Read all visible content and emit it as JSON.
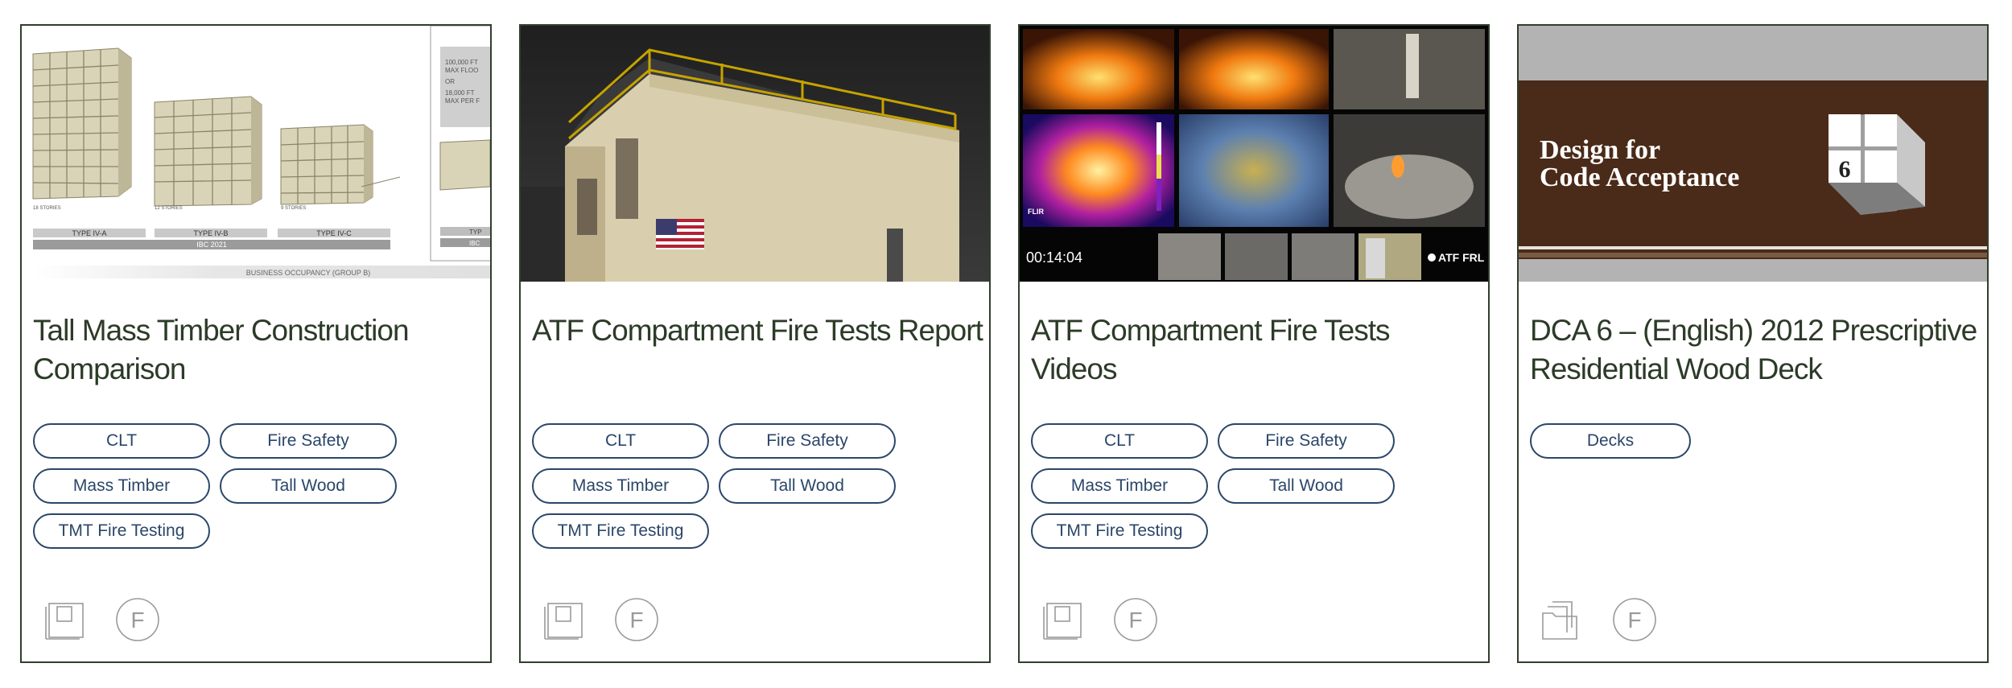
{
  "cards": [
    {
      "title": "Tall Mass Timber Construction Comparison",
      "tags": [
        "CLT",
        "Fire Safety",
        "Mass Timber",
        "Tall Wood",
        "TMT Fire Testing"
      ],
      "thumb": {
        "labels": [
          "TYPE IV-A",
          "TYPE IV-B",
          "TYPE IV-C",
          "IBC 2021",
          "BUSINESS OCCUPANCY (GROUP B)",
          "100,000 FT",
          "MAX FLOO",
          "OR",
          "18,000 FT",
          "MAX PER F",
          "TYP",
          "IBC"
        ],
        "captions": [
          "18 STORIES",
          "12 STORIES",
          "9 STORIES"
        ]
      },
      "icons": [
        "document-icon",
        "letter-f-icon"
      ]
    },
    {
      "title": "ATF Compartment Fire Tests Report",
      "tags": [
        "CLT",
        "Fire Safety",
        "Mass Timber",
        "Tall Wood",
        "TMT Fire Testing"
      ],
      "icons": [
        "document-icon",
        "letter-f-icon"
      ]
    },
    {
      "title": "ATF Compartment Fire Tests Videos",
      "tags": [
        "CLT",
        "Fire Safety",
        "Mass Timber",
        "Tall Wood",
        "TMT Fire Testing"
      ],
      "thumb": {
        "timestamp": "00:14:04",
        "logo": "ATF FRL",
        "flir": "FLIR"
      },
      "icons": [
        "document-icon",
        "letter-f-icon"
      ]
    },
    {
      "title": "DCA 6 – (English) 2012 Prescriptive Residential Wood Deck",
      "tags": [
        "Decks"
      ],
      "thumb": {
        "line1": "Design for",
        "line2": "Code Acceptance",
        "number": "6"
      },
      "icons": [
        "stacked-documents-icon",
        "letter-f-icon"
      ]
    }
  ],
  "icon_letter": "F",
  "colors": {
    "title_text": "#2c3b28",
    "tag_border": "#2a4669",
    "card_border": "#2f3f2c",
    "dca_brown": "#4a2a18",
    "icon_gray": "#9a9a9a"
  }
}
